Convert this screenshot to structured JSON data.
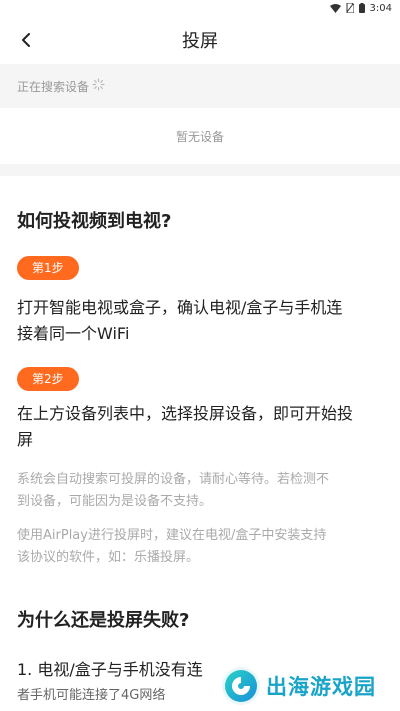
{
  "status_bar": {
    "time": "3:04"
  },
  "nav": {
    "title": "投屏"
  },
  "searching": {
    "label": "正在搜索设备"
  },
  "devices": {
    "empty_label": "暂无设备"
  },
  "guide": {
    "title": "如何投视频到电视?",
    "step1": {
      "badge": "第1步",
      "line1": "打开智能电视或盒子，确认电视/盒子与手机连",
      "line2": "接着同一个WiFi"
    },
    "step2": {
      "badge": "第2步",
      "line1": "在上方设备列表中，选择投屏设备，即可开始投",
      "line2": "屏"
    },
    "note1": {
      "line1": "系统会自动搜索可投屏的设备，请耐心等待。若检测不",
      "line2": "到设备，可能因为是设备不支持。"
    },
    "note2": {
      "line1": "使用AirPlay进行投屏时，建议在电视/盒子中安装支持",
      "line2": "该协议的软件，如：乐播投屏。"
    }
  },
  "failure": {
    "title": "为什么还是投屏失败?",
    "item1_line1": "1. 电视/盒子与手机没有连",
    "item1_line2": "者手机可能连接了4G网络"
  },
  "watermark": {
    "text": "出海游戏园"
  },
  "colors": {
    "accent": "#ff6a1f",
    "muted": "#999999"
  }
}
